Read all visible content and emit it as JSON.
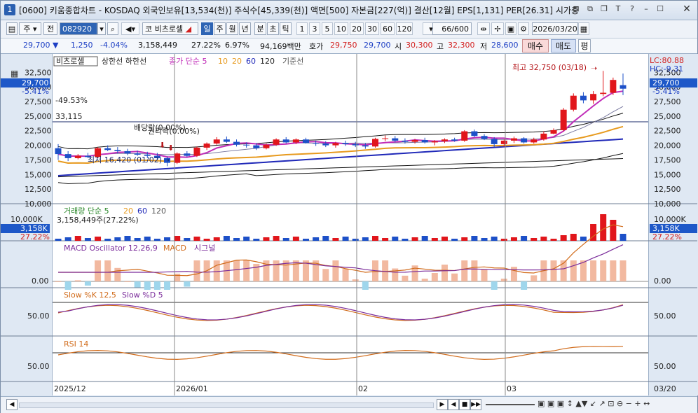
{
  "window": {
    "number": "1",
    "title": "[0600] 키움종합차트 - KOSDAQ 외국인보유[13,534(천)] 주식수[45,339(천)] 액면[500] 자본금[227(억)] 결산[12월] EPS[1,131] PER[26.31] 시가총"
  },
  "toolbar": {
    "type_btn": "주",
    "prev_btn": "전",
    "code": "082920",
    "stock_prefix": "코",
    "stock_name": "비츠로셀",
    "period_tabs": [
      "일",
      "주",
      "월",
      "년",
      "분",
      "초",
      "틱"
    ],
    "active_period": "일",
    "intervals": [
      "1",
      "3",
      "5",
      "10",
      "20",
      "30",
      "60",
      "120"
    ],
    "count": "66",
    "count_total": "/600",
    "date": "2026/03/20"
  },
  "quote": {
    "price": "29,700",
    "change": "1,250",
    "change_pct": "-4.04%",
    "volume": "3,158,449",
    "volume_pct": "27.22%",
    "turnover": "6.97%",
    "amount": "94,169백만",
    "ask_label": "호가",
    "ask": "29,750",
    "bid": "29,700",
    "open_label": "시",
    "open": "30,300",
    "high_label": "고",
    "high": "32,300",
    "low_label": "저",
    "low": "28,600",
    "buy_label": "매수",
    "sell_label": "매도",
    "avg_label": "평"
  },
  "price_panel": {
    "legend_name": "비츠로셀",
    "legend_limits": "상한선  하한선",
    "legend_ma": "종가 단순 5",
    "ma_periods": [
      "10",
      "20",
      "60",
      "120"
    ],
    "legend_base": "기준선",
    "lc": "LC:80.88",
    "hc": "HC:-9.31",
    "current": "29,700",
    "current_pct": "-5.41%",
    "annot_high": "최고 32,750 (03/18)",
    "annot_low": "최저 16,420 (01/02)",
    "annot_left_pct": "-49.53%",
    "annot_left_val": "33,115",
    "annot_div1": "배당락(0.00%)",
    "annot_div2": "권리락(0.00%)",
    "yticks": [
      "32,500",
      "30,000",
      "27,500",
      "25,000",
      "22,500",
      "20,000",
      "17,500",
      "15,000",
      "12,500",
      "10,000"
    ]
  },
  "volume_panel": {
    "legend": "거래량  단순 5",
    "periods": [
      "20",
      "60",
      "120"
    ],
    "detail": "3,158,449주(27.22%)",
    "ytick": "10,000K",
    "current": "3,158K",
    "current_pct": "27.22%"
  },
  "macd_panel": {
    "legend1": "MACD Oscillator 12,26,9",
    "legend2": "MACD",
    "legend3": "시그널",
    "ytick": "0.00"
  },
  "stoch_panel": {
    "legend1": "Slow %K 12,5",
    "legend2": "Slow %D 5",
    "ytick": "50.00"
  },
  "rsi_panel": {
    "legend": "RSI 14",
    "ytick": "50.00"
  },
  "xaxis": [
    "2025/12",
    "2026/01",
    "02",
    "03",
    "03/20"
  ],
  "chart_data": {
    "type": "candlestick",
    "title": "비츠로셀",
    "ylim": [
      10000,
      33500
    ],
    "candles": [
      [
        19500,
        20200,
        17500,
        18500
      ],
      [
        18500,
        19000,
        17300,
        17800
      ],
      [
        17800,
        18500,
        17600,
        18200
      ],
      [
        18200,
        18700,
        17800,
        18000
      ],
      [
        18000,
        19700,
        17800,
        19500
      ],
      [
        19500,
        20000,
        19000,
        19200
      ],
      [
        19200,
        19700,
        18600,
        19000
      ],
      [
        19000,
        19400,
        18300,
        18600
      ],
      [
        18600,
        19100,
        18200,
        18400
      ],
      [
        18400,
        18900,
        17800,
        18200
      ],
      [
        18200,
        18700,
        17500,
        17800
      ],
      [
        17800,
        18100,
        16420,
        17000
      ],
      [
        17000,
        18800,
        16800,
        18600
      ],
      [
        18600,
        19000,
        18000,
        18200
      ],
      [
        18200,
        19800,
        18000,
        19600
      ],
      [
        19600,
        20500,
        19200,
        20300
      ],
      [
        20300,
        21400,
        20100,
        21000
      ],
      [
        21000,
        21500,
        20400,
        20600
      ],
      [
        20600,
        21000,
        19800,
        20100
      ],
      [
        20100,
        20500,
        19600,
        20000
      ],
      [
        20000,
        20400,
        19200,
        19500
      ],
      [
        19500,
        20300,
        19300,
        20100
      ],
      [
        20100,
        21200,
        19900,
        21000
      ],
      [
        21000,
        21400,
        20300,
        20500
      ],
      [
        20500,
        21200,
        20200,
        21000
      ],
      [
        21000,
        21300,
        20300,
        20400
      ],
      [
        20400,
        20800,
        19900,
        20300
      ],
      [
        20300,
        20700,
        19700,
        20000
      ],
      [
        20000,
        20600,
        19600,
        20400
      ],
      [
        20400,
        20800,
        19900,
        20200
      ],
      [
        20200,
        20600,
        19700,
        20000
      ],
      [
        20000,
        20400,
        19400,
        19800
      ],
      [
        19800,
        21300,
        19600,
        21100
      ],
      [
        21100,
        21700,
        20700,
        21200
      ],
      [
        21200,
        21600,
        20500,
        20800
      ],
      [
        20800,
        21200,
        20300,
        20600
      ],
      [
        20600,
        21100,
        20300,
        20900
      ],
      [
        20900,
        21300,
        20300,
        20500
      ],
      [
        20500,
        20900,
        20000,
        20700
      ],
      [
        20700,
        21200,
        20400,
        21000
      ],
      [
        21000,
        21300,
        20600,
        20800
      ],
      [
        20800,
        22600,
        20600,
        22400
      ],
      [
        22400,
        22700,
        21400,
        21600
      ],
      [
        21600,
        21900,
        20900,
        21100
      ],
      [
        21100,
        21400,
        19700,
        20200
      ],
      [
        20200,
        21000,
        19800,
        20800
      ],
      [
        20800,
        21500,
        20400,
        21200
      ],
      [
        21200,
        21400,
        20300,
        20500
      ],
      [
        20500,
        21300,
        20300,
        21000
      ],
      [
        21000,
        22400,
        20800,
        22000
      ],
      [
        22000,
        22900,
        21900,
        22600
      ],
      [
        22600,
        26400,
        22400,
        26100
      ],
      [
        26100,
        28900,
        25800,
        28500
      ],
      [
        28500,
        29100,
        27200,
        27700
      ],
      [
        27700,
        29300,
        27100,
        28800
      ],
      [
        28800,
        32750,
        28400,
        29000
      ],
      [
        29000,
        31600,
        28600,
        31200
      ],
      [
        30300,
        32300,
        28600,
        29700
      ]
    ]
  }
}
